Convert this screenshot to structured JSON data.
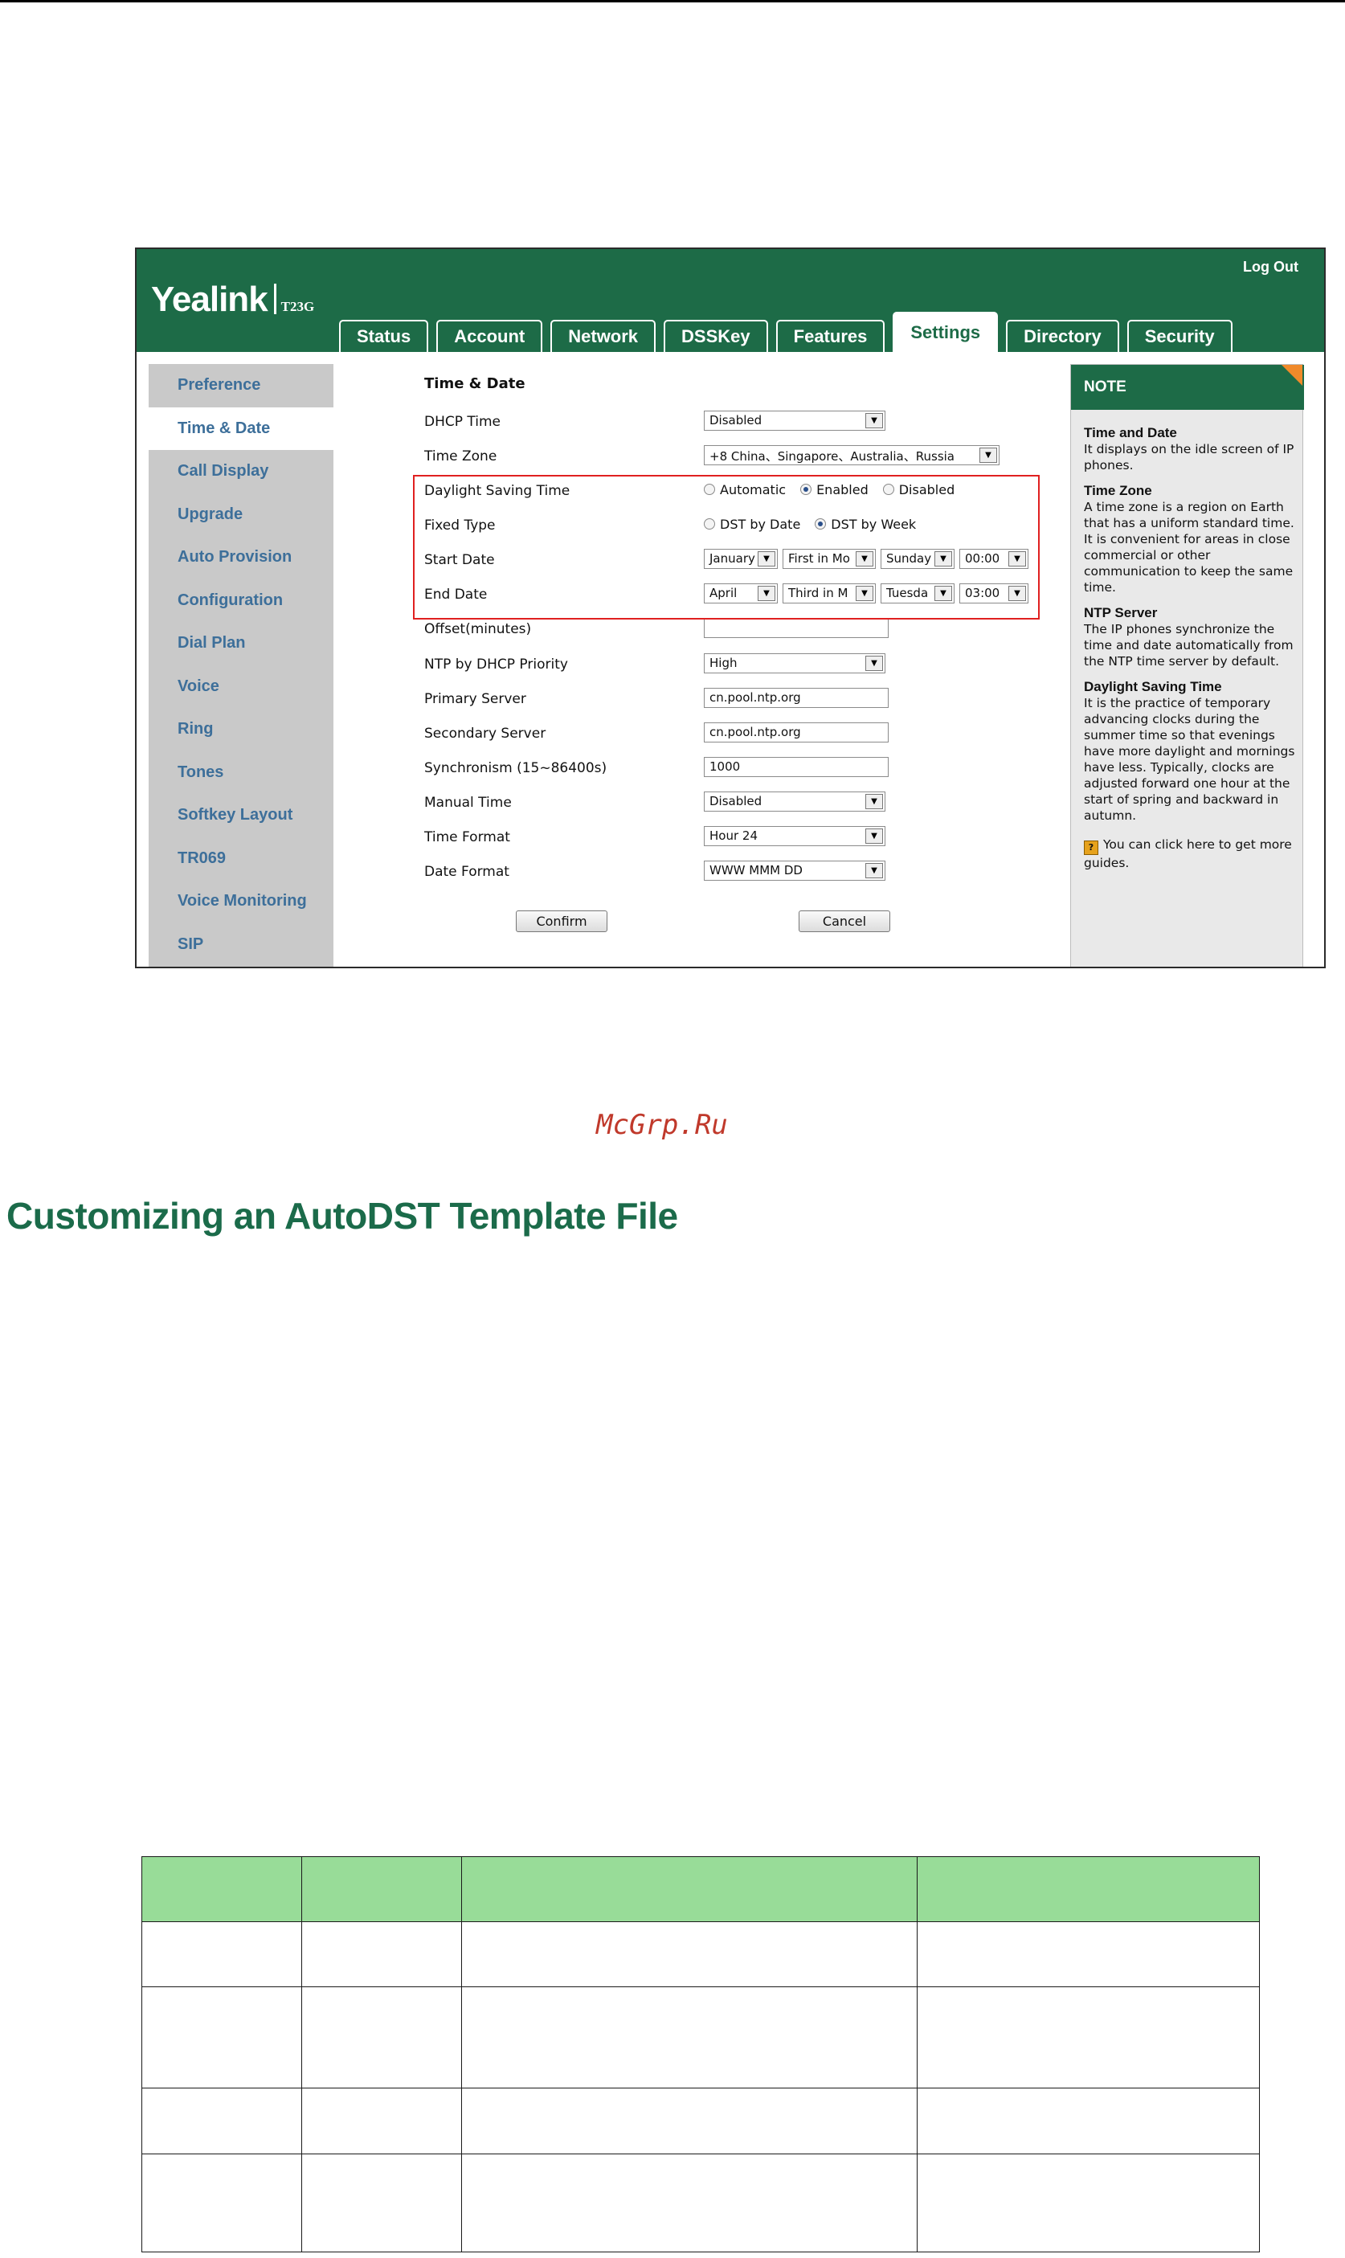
{
  "header": {
    "logo": "Yealink",
    "model": "T23G",
    "logout": "Log Out",
    "tabs": [
      "Status",
      "Account",
      "Network",
      "DSSKey",
      "Features",
      "Settings",
      "Directory",
      "Security"
    ],
    "active_tab": "Settings"
  },
  "sidebar": {
    "items": [
      "Preference",
      "Time & Date",
      "Call Display",
      "Upgrade",
      "Auto Provision",
      "Configuration",
      "Dial Plan",
      "Voice",
      "Ring",
      "Tones",
      "Softkey Layout",
      "TR069",
      "Voice Monitoring",
      "SIP"
    ],
    "active": "Time & Date"
  },
  "form": {
    "title": "Time & Date",
    "dhcp_time": {
      "label": "DHCP Time",
      "value": "Disabled"
    },
    "time_zone": {
      "label": "Time Zone",
      "value": "+8 China、Singapore、Australia、Russia"
    },
    "dst": {
      "label": "Daylight Saving Time",
      "options": [
        "Automatic",
        "Enabled",
        "Disabled"
      ],
      "selected": "Enabled"
    },
    "fixed_type": {
      "label": "Fixed Type",
      "options": [
        "DST by Date",
        "DST by Week"
      ],
      "selected": "DST by Week"
    },
    "start_date": {
      "label": "Start Date",
      "month": "January",
      "week": "First in Mo",
      "day": "Sunday",
      "hour": "00:00"
    },
    "end_date": {
      "label": "End Date",
      "month": "April",
      "week": "Third in M",
      "day": "Tuesda",
      "hour": "03:00"
    },
    "offset": {
      "label": "Offset(minutes)",
      "value": ""
    },
    "ntp_priority": {
      "label": "NTP by DHCP Priority",
      "value": "High"
    },
    "primary_server": {
      "label": "Primary Server",
      "value": "cn.pool.ntp.org"
    },
    "secondary_server": {
      "label": "Secondary Server",
      "value": "cn.pool.ntp.org"
    },
    "synchronism": {
      "label": "Synchronism (15~86400s)",
      "value": "1000"
    },
    "manual_time": {
      "label": "Manual Time",
      "value": "Disabled"
    },
    "time_format": {
      "label": "Time Format",
      "value": "Hour 24"
    },
    "date_format": {
      "label": "Date Format",
      "value": "WWW MMM DD"
    },
    "confirm": "Confirm",
    "cancel": "Cancel"
  },
  "note": {
    "title": "NOTE",
    "sections": [
      {
        "heading": "Time and Date",
        "text": "It displays on the idle screen of IP phones."
      },
      {
        "heading": "Time Zone",
        "text": "A time zone is a region on Earth that has a uniform standard time. It is convenient for areas in close commercial or other communication to keep the same time."
      },
      {
        "heading": "NTP Server",
        "text": "The IP phones synchronize the time and date automatically from the NTP time server by default."
      },
      {
        "heading": "Daylight Saving Time",
        "text": "It is the practice of temporary advancing clocks during the summer time so that evenings have more daylight and mornings have less. Typically, clocks are adjusted forward one hour at the start of spring and backward in autumn."
      }
    ],
    "guide": "You can click here to get more guides."
  },
  "document": {
    "watermark": "McGrp.Ru",
    "section_title": "Customizing an AutoDST Template File"
  },
  "colors": {
    "brand_green": "#1d6b47",
    "table_header": "#98dc98",
    "highlight_box": "#e02020"
  }
}
